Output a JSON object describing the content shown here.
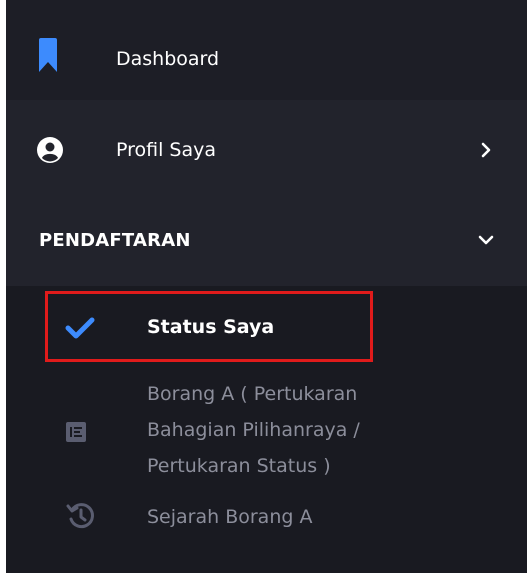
{
  "menu": {
    "dashboard": {
      "label": "Dashboard",
      "icon": "bookmark-icon",
      "color": "#3d8bfd"
    },
    "profil": {
      "label": "Profil Saya",
      "icon": "user-circle-icon",
      "chevron": "chevron-right-icon"
    },
    "pendaftaran": {
      "label": "PENDAFTARAN",
      "chevron": "chevron-down-icon"
    },
    "status": {
      "label": "Status Saya",
      "icon": "check-icon",
      "color": "#3d8bfd",
      "highlight_color": "#e01b1b"
    },
    "borang": {
      "label_lines": [
        "Borang A ( Pertukaran",
        "Bahagian Pilihanraya /",
        "Pertukaran Status )"
      ],
      "icon": "list-icon"
    },
    "sejarah": {
      "label": "Sejarah Borang A",
      "icon": "history-icon"
    }
  }
}
